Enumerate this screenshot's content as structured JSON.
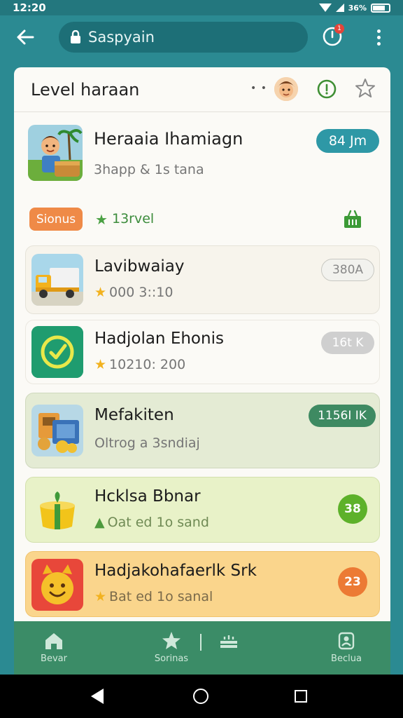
{
  "status_bar": {
    "time": "12:20",
    "indicator": "36%"
  },
  "app_bar": {
    "url": "Saspyain",
    "notification_count": "1"
  },
  "sheet": {
    "title": "Level haraan",
    "header_dots": "• •"
  },
  "featured": {
    "title": "Heraaia Ihamiagn",
    "subtitle": "3happ & 1s tana",
    "badge": "84 Jm"
  },
  "bonus_row": {
    "bonus_label": "Sionus",
    "level_label": "13rvel"
  },
  "items": [
    {
      "title": "Lavibwaiay",
      "subtitle": "000 3::10",
      "badge": "380A"
    },
    {
      "title": "Hadjolan Ehonis",
      "subtitle": "10210: 200",
      "badge": "16t K"
    },
    {
      "title": "Mefakiten",
      "subtitle": "Oltrog a 3sndiaj",
      "badge": "1156I IK"
    },
    {
      "title": "Hcklsa Bbnar",
      "subtitle": "Oat ed 1o sand",
      "badge": "38"
    },
    {
      "title": "Hadjakohafaerlk Srk",
      "subtitle": "Bat ed 1o sanal",
      "badge": "23"
    }
  ],
  "bottom_nav": [
    {
      "label": "Bevar"
    },
    {
      "label": "Sorinas"
    },
    {
      "label": ""
    },
    {
      "label": "Beclua"
    }
  ],
  "colors": {
    "primary": "#2b8a92",
    "accent_teal": "#2e98a6",
    "nav_green": "#3b8c67",
    "star": "#f2b21f"
  }
}
